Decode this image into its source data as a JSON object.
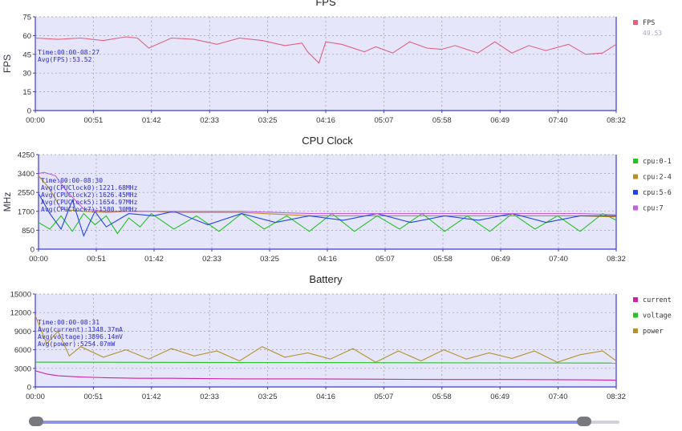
{
  "colors": {
    "plot_bg": "#e6e6fa",
    "axis": "#3b3bd6",
    "grid": "#9999aa"
  },
  "x_ticks": [
    "00:00",
    "00:51",
    "01:42",
    "02:33",
    "03:25",
    "04:16",
    "05:07",
    "05:58",
    "06:49",
    "07:40",
    "08:32"
  ],
  "slider": {
    "start": 0.0,
    "end": 0.94
  },
  "chart_data": [
    {
      "type": "line",
      "title": "FPS",
      "ylabel": "FPS",
      "ylim": [
        0,
        75
      ],
      "yticks": [
        "0",
        "15",
        "30",
        "45",
        "60",
        "75"
      ],
      "xlim": [
        "00:00",
        "08:32"
      ],
      "grid": true,
      "legend_position": "right",
      "annotation": [
        "Time:00:00-08:27",
        "Avg(FPS):53.52"
      ],
      "series": [
        {
          "name": "FPS",
          "color": "#e0607e",
          "legend_value": "49.53",
          "x": [
            "00:00",
            "00:20",
            "00:40",
            "01:00",
            "01:20",
            "01:30",
            "01:40",
            "02:00",
            "02:20",
            "02:40",
            "03:00",
            "03:20",
            "03:40",
            "03:55",
            "04:00",
            "04:10",
            "04:16",
            "04:30",
            "04:50",
            "05:00",
            "05:15",
            "05:30",
            "05:45",
            "05:58",
            "06:10",
            "06:30",
            "06:45",
            "07:00",
            "07:15",
            "07:30",
            "07:50",
            "08:05",
            "08:20",
            "08:32"
          ],
          "values": [
            58,
            57,
            58,
            56,
            59,
            58,
            50,
            58,
            57,
            53,
            58,
            56,
            52,
            54,
            47,
            38,
            55,
            53,
            47,
            51,
            46,
            55,
            50,
            49,
            52,
            46,
            55,
            46,
            52,
            48,
            53,
            45,
            46,
            53
          ]
        }
      ]
    },
    {
      "type": "line",
      "title": "CPU Clock",
      "ylabel": "MHz",
      "ylim": [
        0,
        4250
      ],
      "yticks": [
        "0",
        "850",
        "1700",
        "2550",
        "3400",
        "4250"
      ],
      "xlim": [
        "00:00",
        "08:32"
      ],
      "grid": true,
      "legend_position": "right",
      "annotation": [
        "Time:00:00-08:30",
        "Avg(CPUClock0):1221.68MHz",
        "Avg(CPUClock2):1626.45MHz",
        "Avg(CPUClock5):1654.97MHz",
        "Avg(CPUClock7):1580.30MHz"
      ],
      "series": [
        {
          "name": "cpu:0-1",
          "color": "#22c322",
          "x": [
            "00:00",
            "00:10",
            "00:20",
            "00:30",
            "00:40",
            "00:50",
            "01:00",
            "01:10",
            "01:20",
            "01:30",
            "01:40",
            "02:00",
            "02:20",
            "02:40",
            "03:00",
            "03:20",
            "03:40",
            "04:00",
            "04:20",
            "04:40",
            "05:00",
            "05:20",
            "05:40",
            "06:00",
            "06:20",
            "06:40",
            "07:00",
            "07:20",
            "07:40",
            "08:00",
            "08:20",
            "08:32"
          ],
          "values": [
            1200,
            900,
            1500,
            800,
            1600,
            1100,
            1500,
            700,
            1400,
            1000,
            1600,
            900,
            1500,
            800,
            1600,
            900,
            1500,
            800,
            1600,
            800,
            1500,
            900,
            1600,
            800,
            1500,
            800,
            1600,
            900,
            1500,
            800,
            1600,
            1300
          ]
        },
        {
          "name": "cpu:2-4",
          "color": "#b8902a",
          "x": [
            "00:00",
            "00:10",
            "00:20",
            "00:40",
            "01:00",
            "01:20",
            "01:42",
            "02:00",
            "03:00",
            "04:00",
            "05:00",
            "06:00",
            "07:00",
            "08:00",
            "08:32"
          ],
          "values": [
            3300,
            2700,
            1800,
            1700,
            1650,
            1700,
            1700,
            1650,
            1650,
            1500,
            1500,
            1500,
            1500,
            1500,
            1450
          ]
        },
        {
          "name": "cpu:5-6",
          "color": "#2244ee",
          "x": [
            "00:00",
            "00:10",
            "00:20",
            "00:30",
            "00:40",
            "00:50",
            "01:00",
            "01:20",
            "01:42",
            "02:00",
            "02:30",
            "03:00",
            "03:30",
            "04:00",
            "04:30",
            "05:00",
            "05:30",
            "06:00",
            "06:30",
            "07:00",
            "07:30",
            "08:00",
            "08:32"
          ],
          "values": [
            2500,
            1600,
            900,
            2200,
            600,
            1700,
            1000,
            1600,
            1500,
            1700,
            1100,
            1600,
            1200,
            1500,
            1300,
            1600,
            1200,
            1500,
            1300,
            1600,
            1200,
            1500,
            1500
          ]
        },
        {
          "name": "cpu:7",
          "color": "#c060e0",
          "x": [
            "00:00",
            "00:05",
            "00:15",
            "00:25",
            "00:40",
            "01:00",
            "01:20",
            "01:42",
            "02:00",
            "03:00",
            "03:30",
            "04:00",
            "05:00",
            "06:00",
            "07:00",
            "08:00",
            "08:32"
          ],
          "values": [
            3400,
            3450,
            3300,
            2600,
            1800,
            1700,
            1700,
            1700,
            1700,
            1700,
            1650,
            1600,
            1600,
            1600,
            1600,
            1600,
            1550
          ]
        }
      ]
    },
    {
      "type": "line",
      "title": "Battery",
      "ylabel": "",
      "ylim": [
        0,
        15000
      ],
      "yticks": [
        "0",
        "3000",
        "6000",
        "9000",
        "12000",
        "15000"
      ],
      "xlim": [
        "00:00",
        "08:32"
      ],
      "grid": true,
      "legend_position": "right",
      "annotation": [
        "Time:00:00-08:31",
        "Avg(current):1348.37mA",
        "Avg(voltage):3896.14mV",
        "Avg(power):5254.07mW"
      ],
      "series": [
        {
          "name": "current",
          "color": "#cc22aa",
          "x": [
            "00:00",
            "00:10",
            "00:20",
            "00:40",
            "01:00",
            "01:30",
            "02:00",
            "03:00",
            "04:00",
            "05:00",
            "06:00",
            "07:00",
            "08:00",
            "08:32"
          ],
          "values": [
            2600,
            2100,
            1800,
            1600,
            1500,
            1400,
            1400,
            1300,
            1300,
            1250,
            1200,
            1200,
            1150,
            1100
          ]
        },
        {
          "name": "voltage",
          "color": "#22c322",
          "x": [
            "00:00",
            "08:32"
          ],
          "values": [
            4000,
            3850
          ]
        },
        {
          "name": "power",
          "color": "#b8902a",
          "x": [
            "00:00",
            "00:10",
            "00:20",
            "00:30",
            "00:40",
            "01:00",
            "01:20",
            "01:40",
            "02:00",
            "02:20",
            "02:40",
            "03:00",
            "03:20",
            "03:40",
            "04:00",
            "04:20",
            "04:40",
            "05:00",
            "05:20",
            "05:40",
            "06:00",
            "06:20",
            "06:40",
            "07:00",
            "07:20",
            "07:40",
            "08:00",
            "08:20",
            "08:32"
          ],
          "values": [
            11500,
            7000,
            9000,
            5000,
            6500,
            4800,
            6000,
            4500,
            6200,
            5000,
            5800,
            4200,
            6500,
            4800,
            5500,
            4500,
            6200,
            4000,
            5800,
            4200,
            6000,
            4500,
            5500,
            4600,
            5800,
            4000,
            5200,
            5800,
            4200
          ]
        }
      ]
    }
  ]
}
